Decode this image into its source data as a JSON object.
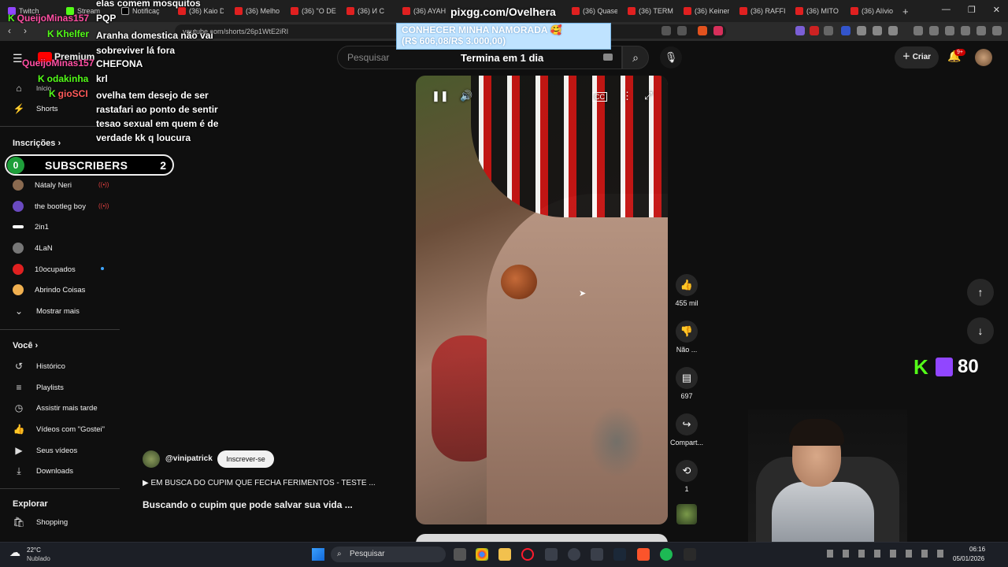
{
  "browser": {
    "tabs": [
      {
        "label": "Twitch"
      },
      {
        "label": "Stream"
      },
      {
        "label": "Notificaç"
      },
      {
        "label": "(36) Kaio D"
      },
      {
        "label": "(36) Melho"
      },
      {
        "label": "(36) \"O DE"
      },
      {
        "label": "(36) И С"
      },
      {
        "label": "(36) AYAH"
      },
      {
        "label": "(36) Quase"
      },
      {
        "label": "(36) TERM"
      },
      {
        "label": "(36) Keiner"
      },
      {
        "label": "(36) RAFFI"
      },
      {
        "label": "(36) MITO"
      },
      {
        "label": "(36) Alívio"
      }
    ],
    "new_tab": "+",
    "url": "youtube.com/shorts/26p1WtE2iRI"
  },
  "youtube": {
    "logo_text": "Premium",
    "search_placeholder": "Pesquisar",
    "create_label": "Criar",
    "notif_badge": "9+"
  },
  "sidebar": {
    "home": "Início",
    "shorts": "Shorts",
    "subscriptions_header": "Inscrições",
    "channels": [
      {
        "name": "Nátaly Neri",
        "live": true,
        "color": "#8a6a50"
      },
      {
        "name": "the bootleg boy",
        "live": true,
        "color": "#6a4ac0"
      },
      {
        "name": "2in1",
        "live": false,
        "color": "#ffffff"
      },
      {
        "name": "4LaN",
        "live": false,
        "color": "#777777"
      },
      {
        "name": "10ocupados",
        "live": false,
        "color": "#e02020"
      },
      {
        "name": "Abrindo Coisas",
        "live": false,
        "color": "#f0b050"
      }
    ],
    "show_more": "Mostrar mais",
    "you_header": "Você",
    "you_items": [
      "Histórico",
      "Playlists",
      "Assistir mais tarde",
      "Vídeos com \"Gostei\"",
      "Seus vídeos",
      "Downloads"
    ],
    "explore_header": "Explorar",
    "explore_items": [
      "Shopping"
    ]
  },
  "chat": {
    "partial_top": "elas comem mosquitos",
    "messages": [
      {
        "user": "QueijoMinas157",
        "user_color": "#ff4fa3",
        "text": "PQP"
      },
      {
        "user": "Khelfer",
        "user_color": "#53fc18",
        "text": "Aranha domestica não vai sobreviver lá fora"
      },
      {
        "user": "QueijoMinas157",
        "user_color": "#ff4fa3",
        "text": "CHEFONA"
      },
      {
        "user": "odakinha",
        "user_color": "#53fc18",
        "text": "krl"
      },
      {
        "user": "gioSCI",
        "user_color": "#ff5a5a",
        "text": "ovelha tem desejo de ser rastafari ao ponto de sentir tesao sexual em quem é de verdade kk q loucura"
      }
    ]
  },
  "overlays": {
    "pix_url": "pixgg.com/Ovelhera",
    "donation_title": "CONHECER MINHA NAMORADA 🥰",
    "donation_amount": "(R$ 606,08/R$ 3.000,00)",
    "countdown": "Termina em 1 dia",
    "subs_label": "SUBSCRIBERS",
    "subs_start": "0",
    "subs_goal": "2",
    "viewer_count": "80"
  },
  "video": {
    "channel_handle": "@vinipatrick",
    "subscribe_label": "Inscrever-se",
    "music_line": "▶ EM BUSCA DO CUPIM QUE FECHA FERIMENTOS - TESTE ...",
    "title": "Buscando o cupim que pode salvar sua vida ...",
    "likes": "455 mil",
    "dislike_label": "Não ...",
    "comments": "697",
    "share_label": "Compart...",
    "remix_count": "1"
  },
  "taskbar": {
    "weather_temp": "22°C",
    "weather_desc": "Nublado",
    "search_label": "Pesquisar",
    "time": "06:16",
    "date": "05/01/2026"
  }
}
